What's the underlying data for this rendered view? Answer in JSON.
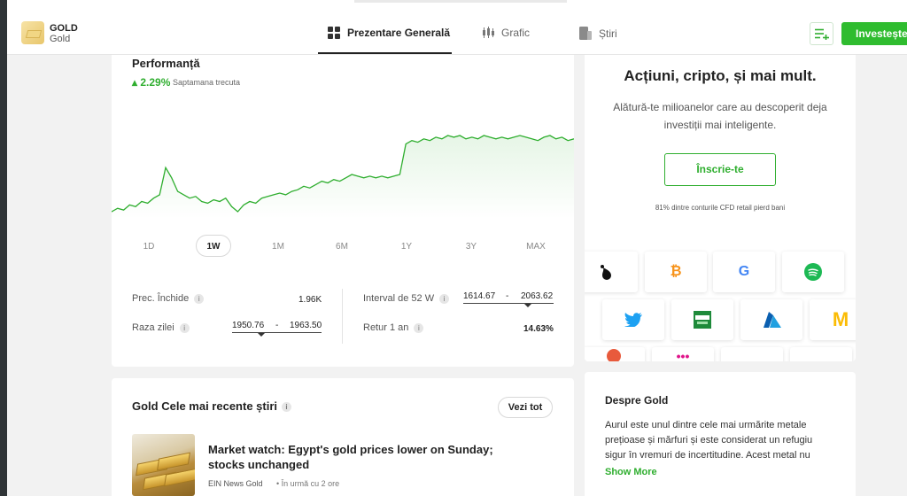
{
  "header": {
    "asset_title": "GOLD",
    "asset_subtitle": "Gold",
    "tabs": [
      {
        "label": "Prezentare Generală",
        "icon": "overview-grid-icon"
      },
      {
        "label": "Grafic",
        "icon": "candlestick-chart-icon"
      },
      {
        "label": "Știri",
        "icon": "news-icon"
      }
    ],
    "invest_label": "Investește",
    "accent_color": "#2fbc2f"
  },
  "performance": {
    "title": "Performanță",
    "change": "2.29%",
    "period": "Saptamana trecuta",
    "ranges": [
      "1D",
      "1W",
      "1M",
      "6M",
      "1Y",
      "3Y",
      "MAX"
    ],
    "active_range": "1W",
    "stats": {
      "prev_close_label": "Prec. Închide",
      "prev_close_value": "1.96K",
      "day_range_label": "Raza zilei",
      "day_low": "1950.76",
      "day_high": "1963.50",
      "week52_label": "Interval de 52 W",
      "week52_low": "1614.67",
      "week52_high": "2063.62",
      "return_label": "Retur 1 an",
      "return_value": "14.63%"
    }
  },
  "chart_data": {
    "type": "area",
    "color": "#2fae2f",
    "values": [
      1920,
      1922,
      1921,
      1924,
      1923,
      1926,
      1925,
      1928,
      1930,
      1946,
      1940,
      1932,
      1930,
      1928,
      1929,
      1926,
      1925,
      1927,
      1926,
      1928,
      1923,
      1920,
      1924,
      1926,
      1925,
      1928,
      1929,
      1930,
      1931,
      1930,
      1932,
      1933,
      1935,
      1934,
      1936,
      1938,
      1937,
      1939,
      1938,
      1940,
      1942,
      1941,
      1940,
      1941,
      1940,
      1941,
      1940,
      1941,
      1942,
      1960,
      1962,
      1961,
      1963,
      1962,
      1964,
      1963,
      1965,
      1964,
      1965,
      1963,
      1964,
      1963,
      1965,
      1964,
      1963,
      1964,
      1963,
      1964,
      1965,
      1964,
      1963,
      1962,
      1964,
      1965,
      1963,
      1964,
      1962,
      1963
    ]
  },
  "news": {
    "title": "Gold Cele mai recente știri",
    "see_all": "Vezi tot",
    "items": [
      {
        "headline": "Market watch: Egypt's gold prices lower on Sunday; stocks unchanged",
        "source": "EIN News Gold",
        "time": "În urmă cu 2 ore"
      }
    ]
  },
  "promo": {
    "title": "Acțiuni, cripto, și mai mult.",
    "text": "Alătură-te milioanelor care au descoperit deja investiții mai inteligente.",
    "signup_label": "Înscrie-te",
    "risk_warning": "81% dintre conturile CFD retail pierd bani",
    "logos": [
      "oil-drop-icon",
      "bitcoin-icon",
      "google-icon",
      "spotify-icon",
      "twitter-icon",
      "sport-tv-icon",
      "azure-icon",
      "mcdonalds-icon"
    ]
  },
  "about": {
    "title": "Despre Gold",
    "text": "Aurul este unul dintre cele mai urmărite metale prețioase și mărfuri și este considerat un refugiu sigur în vremuri de incertitudine. Acest metal nu",
    "show_more": "Show More"
  }
}
